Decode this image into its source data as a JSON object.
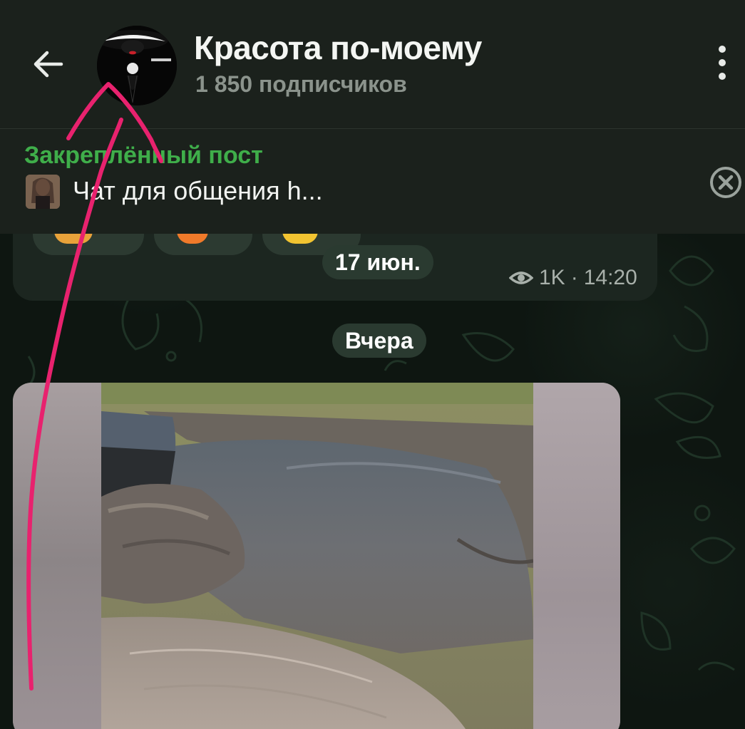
{
  "channel": {
    "title": "Красота по-моему",
    "subtitle": "1 850 подписчиков"
  },
  "pinned": {
    "label": "Закреплённый пост",
    "text": "Чат для общения h..."
  },
  "previous_message": {
    "date_badge": "17 июн.",
    "views": "1K",
    "separator": "·",
    "time": "14:20"
  },
  "date_separator": "Вчера",
  "icons": {
    "back": "arrow-left-icon",
    "more": "more-vertical-icon",
    "close": "close-circle-icon",
    "views": "eye-icon"
  },
  "colors": {
    "header_bg": "#1b211c",
    "pinned_label": "#3fae4a",
    "subtitle": "#8b938c",
    "annotation_stroke": "#e8226e"
  }
}
